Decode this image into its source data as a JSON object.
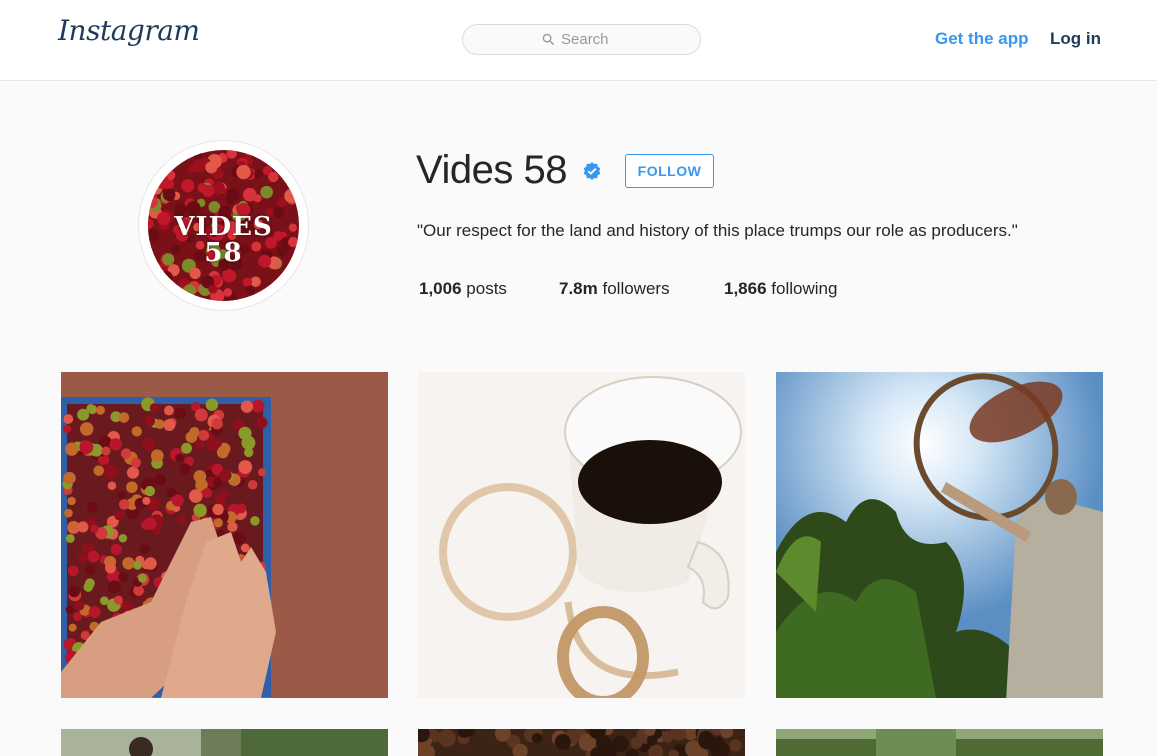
{
  "header": {
    "logo": "Instagram",
    "search_placeholder": "Search",
    "get_app": "Get the app",
    "log_in": "Log in"
  },
  "profile": {
    "avatar_text_line1": "VIDES",
    "avatar_text_line2": "58",
    "username": "Vides 58",
    "verified": true,
    "follow_label": "FOLLOW",
    "bio": "\"Our respect for the land and history of this place trumps our role as producers.\"",
    "stats": [
      {
        "value": "1,006",
        "label": "posts"
      },
      {
        "value": "7.8m",
        "label": "followers"
      },
      {
        "value": "1,866",
        "label": "following"
      }
    ]
  },
  "posts": [
    {
      "subject": "hands on crate of red coffee cherries"
    },
    {
      "subject": "cup of black coffee with stains"
    },
    {
      "subject": "farmer sifting coffee beans in sun"
    },
    {
      "subject": "coffee farm worker"
    },
    {
      "subject": "roasted coffee beans"
    },
    {
      "subject": "coffee plantation trees"
    }
  ],
  "colors": {
    "accent": "#3897f0",
    "brand_dark": "#1f3b5c",
    "background": "#fafafa"
  }
}
